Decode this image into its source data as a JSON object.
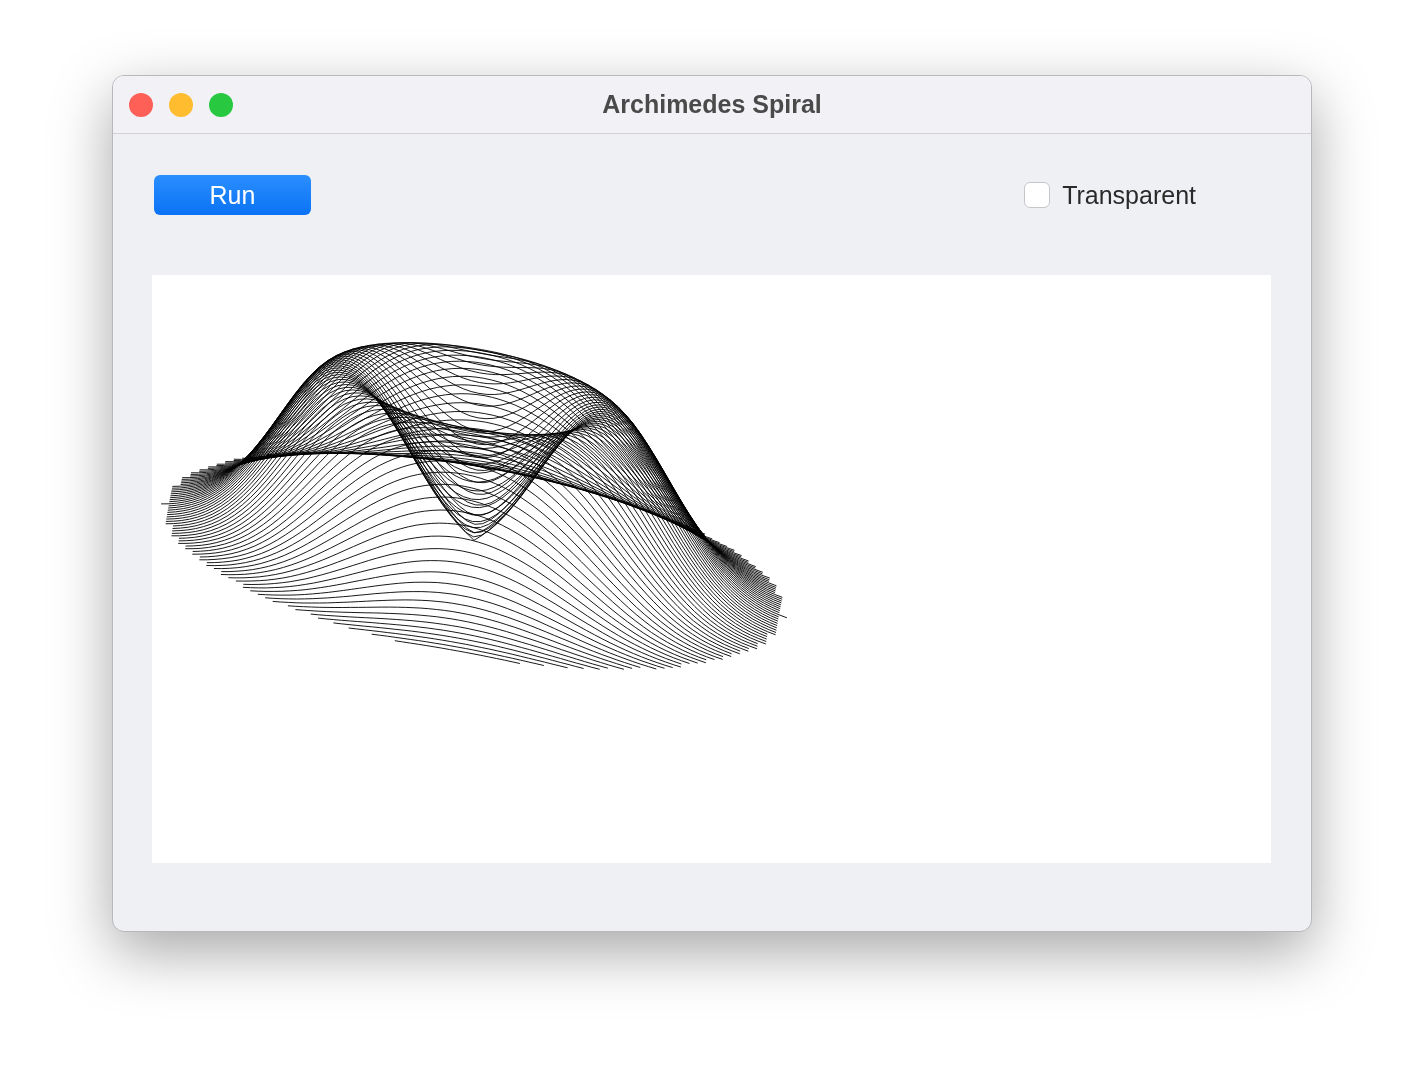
{
  "window": {
    "title": "Archimedes Spiral"
  },
  "run_button": {
    "label": "Run"
  },
  "transparent": {
    "label": "Transparent",
    "checked": false
  }
}
